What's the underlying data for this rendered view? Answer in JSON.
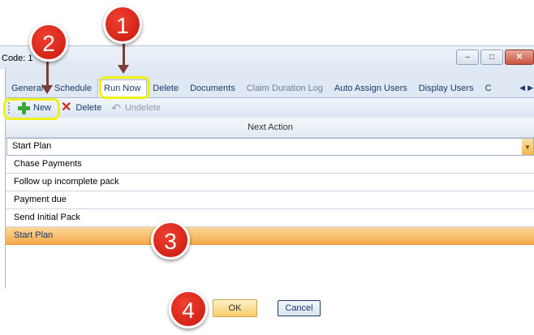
{
  "window": {
    "title": "Code: 1",
    "buttons": [
      "–",
      "□",
      "✕"
    ]
  },
  "tabs": [
    {
      "label": "General",
      "state": "normal"
    },
    {
      "label": "Schedule",
      "state": "normal"
    },
    {
      "label": "Run Now",
      "state": "active"
    },
    {
      "label": "Delete",
      "state": "normal"
    },
    {
      "label": "Documents",
      "state": "normal"
    },
    {
      "label": "Claim Duration Log",
      "state": "dim"
    },
    {
      "label": "Auto Assign Users",
      "state": "normal"
    },
    {
      "label": "Display Users",
      "state": "normal"
    },
    {
      "label": "C",
      "state": "normal"
    }
  ],
  "tab_nav": {
    "prev": "◀",
    "next": "▶"
  },
  "toolbar": {
    "new_label": "New",
    "delete_label": "Delete",
    "undelete_label": "Undelete"
  },
  "grid": {
    "column_header": "Next Action",
    "filter_value": "Start Plan",
    "rows": [
      "Chase Payments",
      "Follow up incomplete pack",
      "Payment due",
      "Send Initial Pack",
      "Start Plan"
    ],
    "selected_row": "Start Plan"
  },
  "dialog": {
    "ok_label": "OK",
    "cancel_label": "Cancel"
  },
  "annotations": {
    "step1": "1",
    "step2": "2",
    "step3": "3",
    "step4": "4"
  },
  "colors": {
    "highlight": "#f0f016",
    "bubble": "#d6241a",
    "selection": "#f4a94a"
  }
}
